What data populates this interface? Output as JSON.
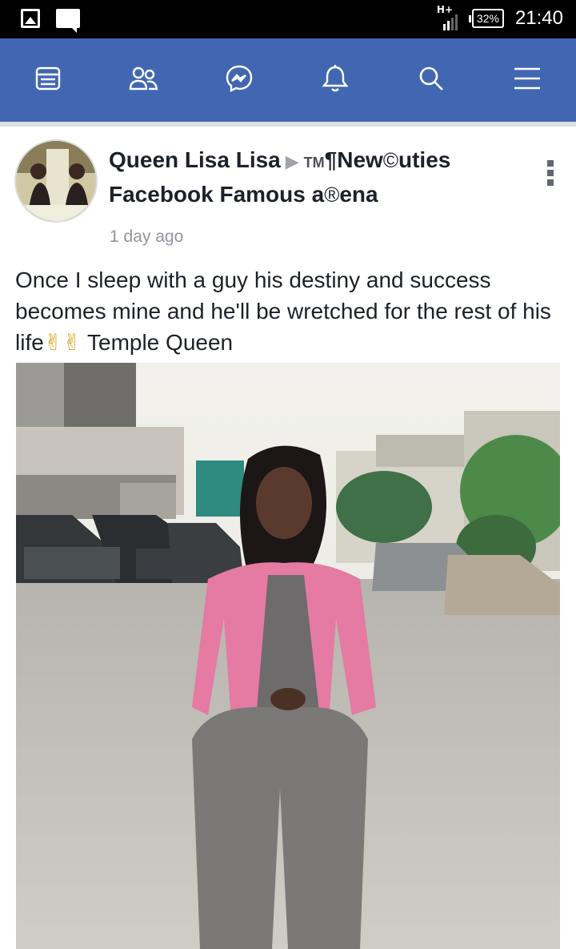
{
  "status_bar": {
    "network": "H+",
    "battery": "32%",
    "time": "21:40"
  },
  "nav": {
    "items": [
      "news-feed",
      "friends",
      "messenger",
      "notifications",
      "search",
      "menu"
    ],
    "bg_color": "#4267b2"
  },
  "post": {
    "author": "Queen Lisa Lisa",
    "group_line1_a": "TM",
    "group_line1_b": "¶New",
    "group_line1_c": "©",
    "group_line1_d": "uties",
    "group_line2_a": "Facebook Famous a",
    "group_line2_b": "®",
    "group_line2_c": "ena",
    "time": "1 day ago",
    "text_main": "Once I sleep with a guy his destiny and success becomes mine and he'll be wretched for the rest of his life",
    "text_emoji": "✌✌",
    "text_tail": " Temple Queen"
  }
}
